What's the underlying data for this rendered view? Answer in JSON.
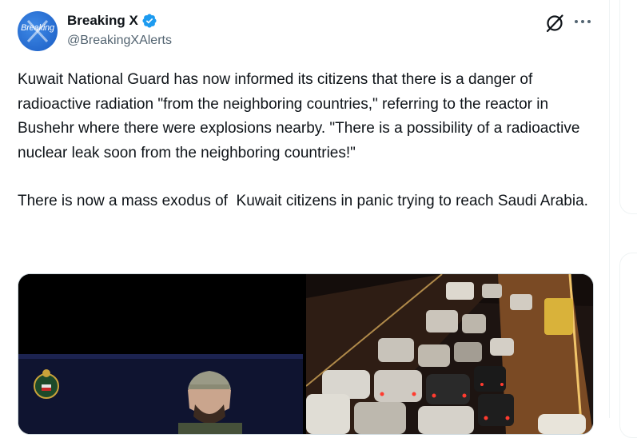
{
  "author": {
    "display_name": "Breaking X",
    "handle": "@BreakingXAlerts",
    "avatar_text": "Breaking"
  },
  "tweet": {
    "paragraph_1": "Kuwait National Guard has now informed its citizens that there is a danger of radioactive radiation \"from the neighboring countries,\" referring to the reactor in Bushehr where there were explosions nearby. \"There is a possibility of a radioactive nuclear leak soon from the neighboring countries!\"",
    "paragraph_2": "There is now a mass exodus of  Kuwait citizens in panic trying to reach Saudi Arabia."
  },
  "icons": {
    "verified": "verified-badge-icon",
    "grok": "grok-icon",
    "more": "more-icon"
  },
  "colors": {
    "verified_blue": "#1d9bf0",
    "text_primary": "#0f1419",
    "text_secondary": "#536471",
    "border": "#cfd9de"
  }
}
